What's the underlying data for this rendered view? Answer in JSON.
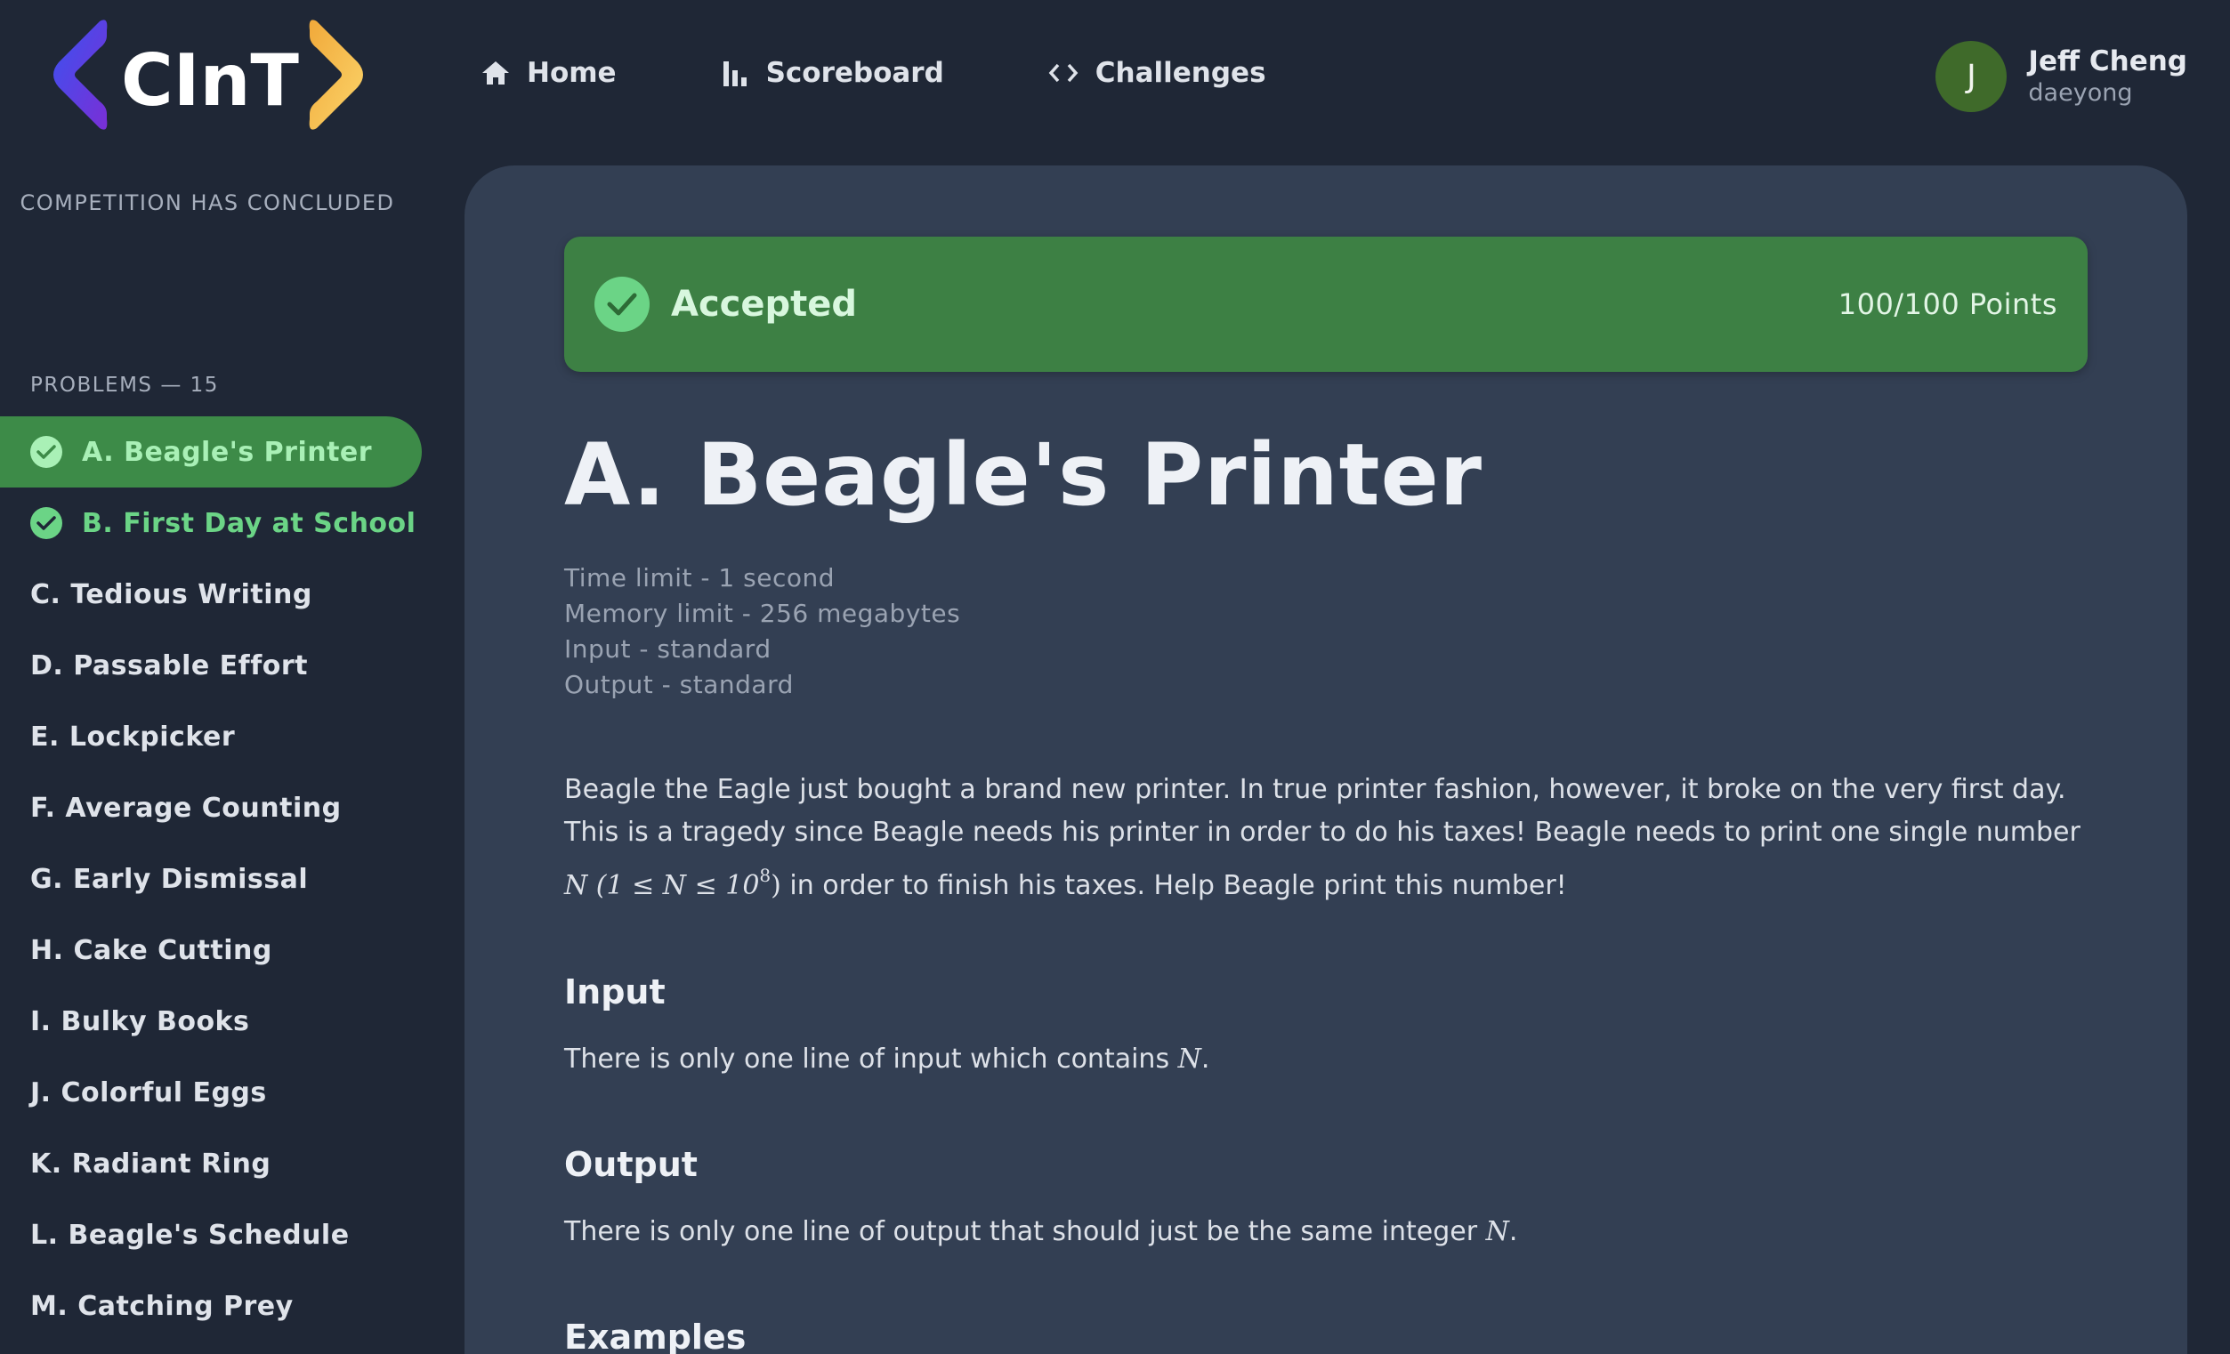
{
  "brand": {
    "logo_text": "CInT"
  },
  "sidebar": {
    "status": "COMPETITION HAS CONCLUDED",
    "problems_heading": "PROBLEMS — 15",
    "problems": [
      {
        "label": "A. Beagle's Printer",
        "solved": true,
        "active": true
      },
      {
        "label": "B. First Day at School",
        "solved": true,
        "active": false
      },
      {
        "label": "C. Tedious Writing",
        "solved": false,
        "active": false
      },
      {
        "label": "D. Passable Effort",
        "solved": false,
        "active": false
      },
      {
        "label": "E. Lockpicker",
        "solved": false,
        "active": false
      },
      {
        "label": "F. Average Counting",
        "solved": false,
        "active": false
      },
      {
        "label": "G. Early Dismissal",
        "solved": false,
        "active": false
      },
      {
        "label": "H. Cake Cutting",
        "solved": false,
        "active": false
      },
      {
        "label": "I. Bulky Books",
        "solved": false,
        "active": false
      },
      {
        "label": "J. Colorful Eggs",
        "solved": false,
        "active": false
      },
      {
        "label": "K. Radiant Ring",
        "solved": false,
        "active": false
      },
      {
        "label": "L. Beagle's Schedule",
        "solved": false,
        "active": false
      },
      {
        "label": "M. Catching Prey",
        "solved": false,
        "active": false
      }
    ]
  },
  "nav": {
    "home": {
      "label": "Home",
      "icon": "home-icon"
    },
    "scoreboard": {
      "label": "Scoreboard",
      "icon": "bar-chart-icon"
    },
    "challenges": {
      "label": "Challenges",
      "icon": "code-icon"
    }
  },
  "user": {
    "initial": "J",
    "name": "Jeff Cheng",
    "handle": "daeyong"
  },
  "submission": {
    "status": "Accepted",
    "points": "100/100 Points"
  },
  "problem": {
    "title": "A. Beagle's Printer",
    "limits": {
      "time": "Time limit - 1 second",
      "memory": "Memory limit - 256 megabytes",
      "input": "Input - standard",
      "output": "Output - standard"
    },
    "statement": {
      "text_before": "Beagle the Eagle just bought a brand new printer. In true printer fashion, however, it broke on the very first day. This is a tragedy since Beagle needs his printer in order to do his taxes! Beagle needs to print one single number ",
      "math_main": "N (1 ≤ N ≤ 10",
      "math_sup": "8",
      "math_close": ")",
      "text_after": " in order to finish his taxes. Help Beagle print this number!"
    },
    "input_heading": "Input",
    "input_text": "There is only one line of input which contains ",
    "input_math": "N",
    "input_end": ".",
    "output_heading": "Output",
    "output_text": "There is only one line of output that should just be the same integer ",
    "output_math": "N",
    "output_end": ".",
    "examples_heading": "Examples"
  },
  "colors": {
    "background": "#1f2736",
    "panel": "#333f53",
    "accepted": "#3d8044",
    "solved_text": "#6bd486",
    "logo_left": "#5a34e0",
    "logo_right": "#f5c04a",
    "avatar": "#3f6a2a"
  }
}
